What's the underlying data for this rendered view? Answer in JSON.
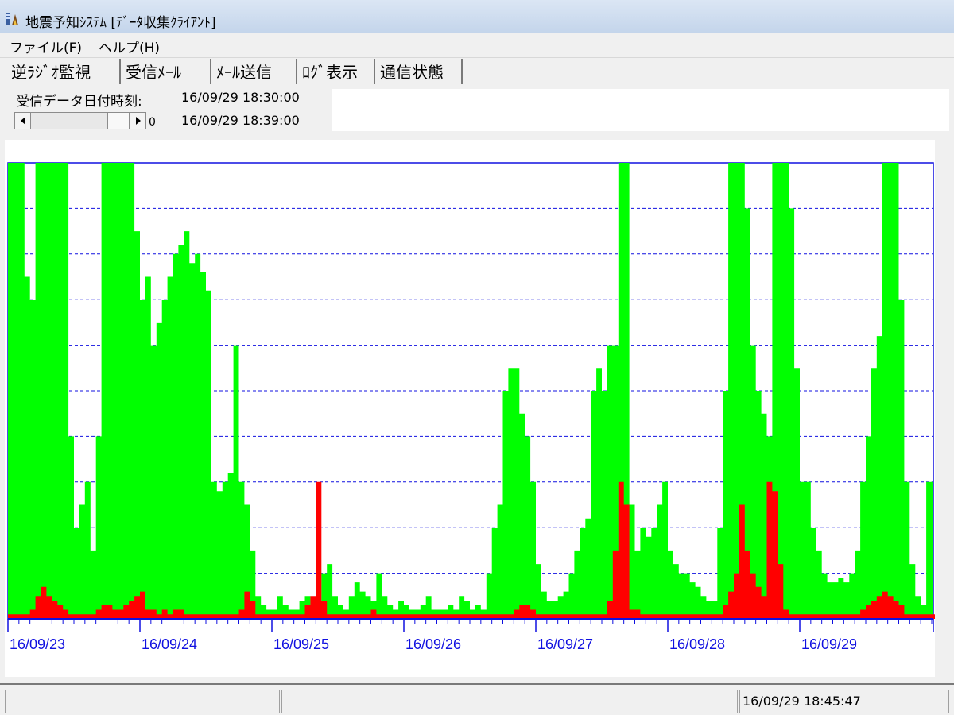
{
  "window": {
    "title": "地震予知ｼｽﾃﾑ [ﾃﾞｰﾀ収集ｸﾗｲｱﾝﾄ]",
    "app_icon": "seismograph-app-icon"
  },
  "menu": [
    {
      "label": "ファイル(F)"
    },
    {
      "label": "ヘルプ(H)"
    }
  ],
  "tabs": [
    {
      "label": "逆ﾗｼﾞｵ監視",
      "active": true
    },
    {
      "label": "受信ﾒｰﾙ",
      "active": false
    },
    {
      "label": "ﾒｰﾙ送信",
      "active": false
    },
    {
      "label": "ﾛｸﾞ表示",
      "active": false
    },
    {
      "label": "通信状態",
      "active": false
    }
  ],
  "info": {
    "received_label": "受信データ日付時刻:",
    "time_start": "16/09/29 18:30:00",
    "time_end": "16/09/29 18:39:00",
    "scroll_value": "0"
  },
  "status": {
    "clock": "16/09/29 18:45:47"
  },
  "colors": {
    "green_series": "#00ff00",
    "red_series": "#ff0000",
    "axis": "#1010e0",
    "grid": "#1010e0"
  },
  "chart_data": {
    "type": "area",
    "x_tick_labels": [
      "16/09/23",
      "16/09/24",
      "16/09/25",
      "16/09/26",
      "16/09/27",
      "16/09/28",
      "16/09/29"
    ],
    "y_scale": "level relative to full scale (0–1), 10 gridline divisions, no numeric tick labels",
    "y_range": [
      0,
      1
    ],
    "grid": "horizontal dashed",
    "series": [
      {
        "color": "green",
        "x_start": "16/09/23 00:00",
        "x_end": "16/09/30 08:00",
        "samples_per_day": 24,
        "values": [
          1.0,
          1.0,
          1.0,
          0.75,
          0.7,
          1.0,
          1.0,
          1.0,
          1.0,
          1.0,
          1.0,
          0.4,
          0.2,
          0.25,
          0.3,
          0.15,
          0.4,
          1.0,
          1.0,
          1.0,
          1.0,
          1.0,
          1.0,
          0.85,
          0.7,
          0.75,
          0.6,
          0.65,
          0.7,
          0.75,
          0.8,
          0.82,
          0.85,
          0.78,
          0.8,
          0.76,
          0.72,
          0.3,
          0.28,
          0.3,
          0.32,
          0.6,
          0.3,
          0.25,
          0.15,
          0.05,
          0.03,
          0.02,
          0.02,
          0.05,
          0.03,
          0.02,
          0.02,
          0.04,
          0.05,
          0.02,
          0.03,
          0.1,
          0.12,
          0.05,
          0.03,
          0.02,
          0.05,
          0.08,
          0.06,
          0.05,
          0.04,
          0.1,
          0.05,
          0.03,
          0.02,
          0.04,
          0.03,
          0.02,
          0.02,
          0.03,
          0.05,
          0.02,
          0.02,
          0.02,
          0.03,
          0.02,
          0.05,
          0.04,
          0.02,
          0.03,
          0.02,
          0.1,
          0.2,
          0.25,
          0.5,
          0.55,
          0.55,
          0.45,
          0.4,
          0.3,
          0.12,
          0.06,
          0.04,
          0.04,
          0.05,
          0.06,
          0.1,
          0.15,
          0.2,
          0.22,
          0.5,
          0.55,
          0.5,
          0.6,
          0.6,
          1.0,
          1.0,
          0.25,
          0.15,
          0.2,
          0.18,
          0.2,
          0.25,
          0.3,
          0.15,
          0.12,
          0.1,
          0.1,
          0.08,
          0.07,
          0.05,
          0.04,
          0.04,
          0.2,
          0.5,
          1.0,
          1.0,
          1.0,
          0.9,
          0.6,
          0.5,
          0.45,
          0.4,
          1.0,
          1.0,
          1.0,
          0.9,
          0.55,
          0.3,
          0.3,
          0.2,
          0.15,
          0.1,
          0.08,
          0.08,
          0.09,
          0.08,
          0.1,
          0.15,
          0.3,
          0.4,
          0.55,
          0.62,
          1.0,
          1.0,
          1.0,
          0.7,
          0.3,
          0.12,
          0.05,
          0.03,
          0.3
        ],
        "note_peaks": "tall spikes appear between saturated blocks"
      },
      {
        "color": "red",
        "x_start": "16/09/23 00:00",
        "x_end": "16/09/30 08:00",
        "samples_per_day": 24,
        "values": [
          0.01,
          0.01,
          0.01,
          0.01,
          0.02,
          0.05,
          0.07,
          0.05,
          0.04,
          0.03,
          0.02,
          0.01,
          0.01,
          0.01,
          0.01,
          0.01,
          0.02,
          0.03,
          0.03,
          0.02,
          0.02,
          0.03,
          0.04,
          0.05,
          0.06,
          0.02,
          0.02,
          0.01,
          0.02,
          0.01,
          0.02,
          0.02,
          0.01,
          0.01,
          0.01,
          0.01,
          0.01,
          0.01,
          0.01,
          0.01,
          0.01,
          0.01,
          0.02,
          0.06,
          0.04,
          0.01,
          0.01,
          0.01,
          0.01,
          0.01,
          0.01,
          0.01,
          0.01,
          0.01,
          0.03,
          0.05,
          0.3,
          0.04,
          0.01,
          0.01,
          0.01,
          0.01,
          0.01,
          0.01,
          0.01,
          0.01,
          0.02,
          0.01,
          0.01,
          0.01,
          0.01,
          0.01,
          0.01,
          0.01,
          0.01,
          0.01,
          0.01,
          0.01,
          0.01,
          0.01,
          0.01,
          0.01,
          0.01,
          0.01,
          0.01,
          0.01,
          0.01,
          0.01,
          0.01,
          0.01,
          0.01,
          0.01,
          0.02,
          0.03,
          0.03,
          0.02,
          0.01,
          0.01,
          0.01,
          0.01,
          0.01,
          0.01,
          0.01,
          0.01,
          0.01,
          0.01,
          0.01,
          0.01,
          0.01,
          0.04,
          0.15,
          0.3,
          0.25,
          0.02,
          0.02,
          0.01,
          0.01,
          0.01,
          0.01,
          0.01,
          0.01,
          0.01,
          0.01,
          0.01,
          0.01,
          0.01,
          0.01,
          0.01,
          0.01,
          0.01,
          0.03,
          0.06,
          0.1,
          0.25,
          0.15,
          0.1,
          0.07,
          0.05,
          0.3,
          0.28,
          0.12,
          0.02,
          0.01,
          0.01,
          0.01,
          0.01,
          0.01,
          0.01,
          0.01,
          0.01,
          0.01,
          0.01,
          0.01,
          0.01,
          0.01,
          0.02,
          0.03,
          0.04,
          0.05,
          0.06,
          0.05,
          0.04,
          0.03,
          0.01,
          0.01,
          0.01,
          0.01,
          0.01,
          0.01
        ]
      }
    ]
  }
}
